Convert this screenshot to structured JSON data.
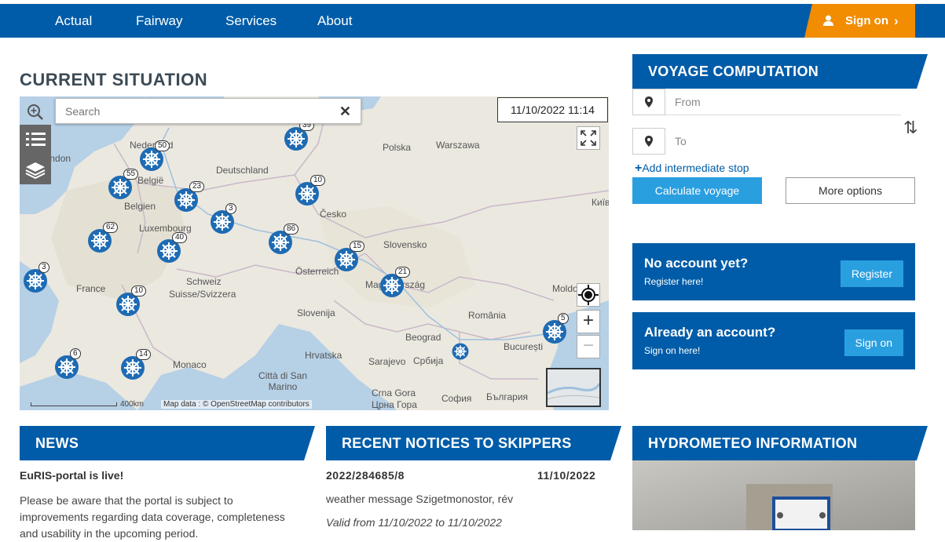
{
  "nav": {
    "items": [
      "Actual",
      "Fairway",
      "Services",
      "About"
    ],
    "sign_on": "Sign on"
  },
  "current": {
    "title": "CURRENT SITUATION",
    "search_placeholder": "Search",
    "datetime": "11/10/2022 11:14",
    "scale": "400km",
    "attribution": "Map data : © OpenStreetMap contributors",
    "places": [
      "London",
      "Nederland",
      "België",
      "Belgien",
      "Luxembourg",
      "Deutschland",
      "Polska",
      "Warszawa",
      "Česko",
      "Slovensko",
      "Österreich",
      "Magyarország",
      "Schweiz",
      "Suisse/Svizzera",
      "France",
      "Slovenija",
      "Hrvatska",
      "România",
      "Beograd",
      "Србија",
      "București",
      "Monaco",
      "Sarajevo",
      "Città di San Marino",
      "Crna Gora",
      "Црна Гора",
      "София",
      "България",
      "Київ",
      "Moldova"
    ],
    "markers": [
      "39",
      "50",
      "55",
      "23",
      "3",
      "10",
      "62",
      "40",
      "86",
      "15",
      "21",
      "3",
      "10",
      "6",
      "14",
      "5"
    ]
  },
  "voyage": {
    "title": "VOYAGE COMPUTATION",
    "from_placeholder": "From",
    "to_placeholder": "To",
    "add_stop": "Add intermediate stop",
    "calc_label": "Calculate voyage",
    "more_label": "More options"
  },
  "account_new": {
    "title": "No account yet?",
    "subtitle": "Register here!",
    "button": "Register"
  },
  "account_existing": {
    "title": "Already an account?",
    "subtitle": "Sign on here!",
    "button": "Sign on"
  },
  "news": {
    "heading": "NEWS",
    "item_title": "EuRIS-portal is live!",
    "item_body": "Please be aware that the portal is subject to improvements regarding data coverage, completeness and usability in the upcoming period."
  },
  "notices": {
    "heading": "RECENT NOTICES TO SKIPPERS",
    "id": "2022/284685/8",
    "date": "11/10/2022",
    "message": "weather message Szigetmonostor, rév",
    "valid": "Valid from 11/10/2022 to 11/10/2022"
  },
  "hydro": {
    "heading": "HYDROMETEO INFORMATION"
  },
  "colors": {
    "brand_blue": "#005ca8",
    "accent_orange": "#f28c00",
    "button_blue": "#2a9fe0",
    "marker_blue": "#1e6bb3"
  }
}
